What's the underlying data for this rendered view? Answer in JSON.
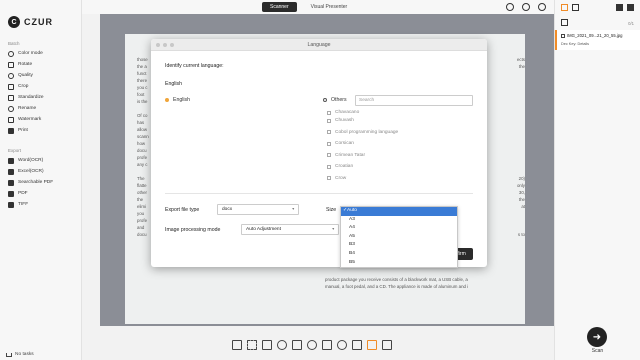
{
  "app": {
    "logo_letter": "C",
    "logo_text": "CZUR"
  },
  "sidebar": {
    "batch_label": "Batch",
    "batch_items": [
      {
        "label": "Color mode",
        "icon": "palette-icon"
      },
      {
        "label": "Rotate",
        "icon": "rotate-icon"
      },
      {
        "label": "Quality",
        "icon": "quality-icon"
      },
      {
        "label": "Crop",
        "icon": "crop-icon"
      },
      {
        "label": "Standardize",
        "icon": "standardize-icon"
      },
      {
        "label": "Rename",
        "icon": "rename-icon"
      },
      {
        "label": "Watermark",
        "icon": "watermark-icon"
      },
      {
        "label": "Print",
        "icon": "print-icon"
      }
    ],
    "export_label": "Export",
    "export_items": [
      {
        "label": "Word(OCR)",
        "icon": "word-icon"
      },
      {
        "label": "Excel(OCR)",
        "icon": "excel-icon"
      },
      {
        "label": "Searchable PDF",
        "icon": "searchable-pdf-icon"
      },
      {
        "label": "PDF",
        "icon": "pdf-icon"
      },
      {
        "label": "TIFF",
        "icon": "tiff-icon"
      }
    ],
    "no_tasks": "No tasks"
  },
  "topbar": {
    "tabs": [
      {
        "label": "Scanner",
        "active": true
      },
      {
        "label": "Visual Presenter",
        "active": false
      }
    ]
  },
  "document": {
    "left_lines": [
      "those",
      "the a",
      "funct",
      "there",
      "you c",
      "foot",
      "is the",
      "",
      "Of co",
      "has",
      "allow",
      "scann",
      "how",
      "docu",
      "profe",
      "any c",
      "",
      "The",
      "flatte",
      "other",
      "the",
      "elimi",
      "you",
      "profe",
      "and",
      "docu"
    ],
    "right_lines": [
      "ects",
      "the",
      "",
      "",
      "",
      "",
      "",
      "",
      "",
      "",
      "",
      "",
      "",
      "",
      "",
      "",
      "",
      "20)",
      "only",
      "30,",
      "the",
      "at",
      "",
      "",
      "",
      "s to"
    ],
    "bottom_lines": [
      "product package you receive consists of a blackwork mat, a USB cable, a",
      "manual, a foot pedal, and a CD. The appliance is made of aluminum and i"
    ]
  },
  "dialog": {
    "title": "Language",
    "identify_label": "Identify current language:",
    "current_language": "English",
    "english_option": "English",
    "others_option": "Others",
    "search_placeholder": "Search",
    "languages": [
      "Chavacano",
      "Chuvash",
      "Cobol programming language",
      "Corsican",
      "Crimean Tatar",
      "Croatian",
      "Crow"
    ],
    "export_type_label": "Export file type",
    "export_type_value": "docx",
    "size_label": "Size",
    "image_mode_label": "Image processing mode",
    "image_mode_value": "Auto Adjustment",
    "confirm_label": "Confirm"
  },
  "size_dropdown": {
    "options": [
      "Auto",
      "A3",
      "A4",
      "A5",
      "B3",
      "B4",
      "B5"
    ],
    "selected": "Auto"
  },
  "toolbar": {
    "icons": [
      "fit-screen-icon",
      "select-area-icon",
      "crop-icon",
      "rotate-icon",
      "adjust-icon",
      "color-icon",
      "erase-icon",
      "undo-icon",
      "copy-icon",
      "ocr-icon",
      "qr-icon"
    ]
  },
  "right_panel": {
    "count": "0/1",
    "file_name": "IMG_2021_09...21_20_55.jpg",
    "file_sub": "Dec Key: Details",
    "scan_label": "Scan"
  },
  "colors": {
    "accent": "#f08c28",
    "dark": "#2b2b2b",
    "selection": "#3a7bd5"
  }
}
